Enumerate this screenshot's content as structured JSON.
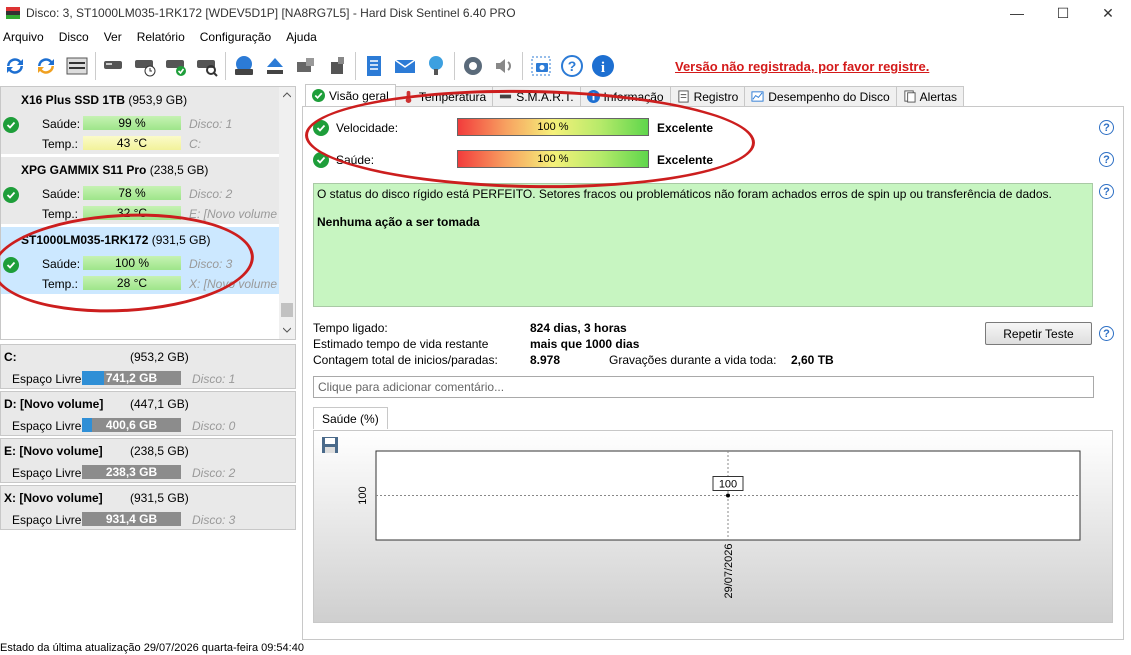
{
  "window": {
    "title": "Disco: 3, ST1000LM035-1RK172 [WDEV5D1P]  [NA8RG7L5] -  Hard Disk Sentinel 6.40 PRO",
    "minimize": "—",
    "maximize": "☐",
    "close": "✕"
  },
  "menu": [
    "Arquivo",
    "Disco",
    "Ver",
    "Relatório",
    "Configuração",
    "Ajuda"
  ],
  "toolbar": {
    "unregistered_text": "Versão não registrada, por favor registre."
  },
  "disks": [
    {
      "name": "X16 Plus SSD 1TB",
      "size": "(953,9 GB)",
      "health_label": "Saúde:",
      "health": "99 %",
      "health_pct": 99,
      "temp_label": "Temp.:",
      "temp": "43 °C",
      "temp_color": "yellow",
      "disk": "Disco: 1",
      "volume": "C:"
    },
    {
      "name": "XPG GAMMIX S11 Pro",
      "size": "(238,5 GB)",
      "health_label": "Saúde:",
      "health": "78 %",
      "health_pct": 78,
      "temp_label": "Temp.:",
      "temp": "32 °C",
      "temp_color": "green",
      "disk": "Disco: 2",
      "volume": "E: [Novo volume"
    },
    {
      "name": "ST1000LM035-1RK172",
      "size": "(931,5 GB)",
      "health_label": "Saúde:",
      "health": "100 %",
      "health_pct": 100,
      "temp_label": "Temp.:",
      "temp": "28 °C",
      "temp_color": "green",
      "disk": "Disco: 3",
      "volume": "X: [Novo volume"
    }
  ],
  "volumes": [
    {
      "name": "C:",
      "size": "(953,2 GB)",
      "free_label": "Espaço Livre",
      "free": "741,2 GB",
      "used_pct": 22,
      "disk": "Disco: 1"
    },
    {
      "name": "D: [Novo volume]",
      "size": "(447,1 GB)",
      "free_label": "Espaço Livre",
      "free": "400,6 GB",
      "used_pct": 10,
      "disk": "Disco: 0"
    },
    {
      "name": "E: [Novo volume]",
      "size": "(238,5 GB)",
      "free_label": "Espaço Livre",
      "free": "238,3 GB",
      "used_pct": 0,
      "disk": "Disco: 2"
    },
    {
      "name": "X: [Novo volume]",
      "size": "(931,5 GB)",
      "free_label": "Espaço Livre",
      "free": "931,4 GB",
      "used_pct": 0,
      "disk": "Disco: 3"
    }
  ],
  "tabs": [
    "Visão geral",
    "Temperatura",
    "S.M.A.R.T.",
    "Informação",
    "Registro",
    "Desempenho do Disco",
    "Alertas"
  ],
  "overview": {
    "speed_label": "Velocidade:",
    "speed_value": "100 %",
    "speed_rating": "Excelente",
    "health_label": "Saúde:",
    "health_value": "100 %",
    "health_rating": "Excelente",
    "status_text": "O status do disco rígido está PERFEITO. Setores fracos ou problemáticos não foram achados erros de spin up ou transferência de dados.",
    "action_text": "Nenhuma ação a ser tomada",
    "power_on_label": "Tempo ligado:",
    "power_on_value": "824 dias, 3 horas",
    "remaining_label": "Estimado tempo de vida restante",
    "remaining_value": "mais que 1000 dias",
    "starts_label": "Contagem total de inicios/paradas:",
    "starts_value": "8.978",
    "writes_label": "Gravações durante a vida toda:",
    "writes_value": "2,60 TB",
    "retest_button": "Repetir Teste",
    "comment_placeholder": "Clique para adicionar  comentário...",
    "graph_tab": "Saúde (%)"
  },
  "chart_data": {
    "type": "line",
    "x": [
      "29/07/2026"
    ],
    "series": [
      {
        "values": [
          100
        ]
      }
    ],
    "ytick": "100",
    "point_label": "100"
  },
  "statusbar": {
    "text": "Estado da última atualização 29/07/2026 quarta-feira 09:54:40"
  },
  "colors": {
    "check_green": "#1e9e3a",
    "annotation_red": "#cc1e1e",
    "status_green": "#c7f5c1",
    "unregistered_red": "#d41a1a",
    "volume_blue": "#2f8fd6"
  }
}
